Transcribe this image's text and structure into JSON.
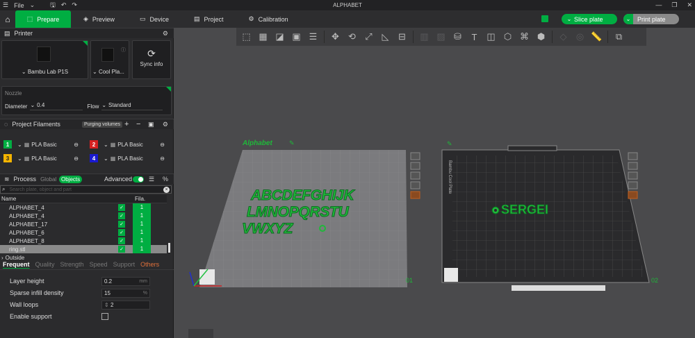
{
  "app": {
    "title": "ALPHABET",
    "menu_label": "File"
  },
  "tabs": [
    {
      "label": "Prepare"
    },
    {
      "label": "Preview"
    },
    {
      "label": "Device"
    },
    {
      "label": "Project"
    },
    {
      "label": "Calibration"
    }
  ],
  "actions": {
    "slice_label": "Slice plate",
    "print_label": "Print plate"
  },
  "printer": {
    "section_label": "Printer",
    "model": "Bambu Lab P1S",
    "plate": "Cool Pla...",
    "sync_label": "Sync info"
  },
  "nozzle": {
    "label": "Nozzle",
    "diameter_label": "Diameter",
    "diameter_value": "0.4",
    "flow_label": "Flow",
    "flow_value": "Standard"
  },
  "filaments": {
    "section_label": "Project Filaments",
    "purging_label": "Purging volumes",
    "items": [
      {
        "num": "1",
        "name": "PLA Basic",
        "color": "#00ae42"
      },
      {
        "num": "2",
        "name": "PLA Basic",
        "color": "#d62020"
      },
      {
        "num": "3",
        "name": "PLA Basic",
        "color": "#f5b400"
      },
      {
        "num": "4",
        "name": "PLA Basic",
        "color": "#1a1ad0"
      }
    ]
  },
  "process": {
    "section_label": "Process",
    "global_label": "Global",
    "objects_label": "Objects",
    "advanced_label": "Advanced",
    "search_placeholder": "Search plate, object and part",
    "col_name": "Name",
    "col_fila": "Fila.",
    "objects": [
      {
        "name": "ALPHABET_4",
        "fila": "1"
      },
      {
        "name": "ALPHABET_4",
        "fila": "1"
      },
      {
        "name": "ALPHABET_17",
        "fila": "1"
      },
      {
        "name": "ALPHABET_6",
        "fila": "1"
      },
      {
        "name": "ALPHABET_8",
        "fila": "1"
      },
      {
        "name": "ring.stl",
        "fila": "1"
      }
    ],
    "outside_label": "Outside",
    "subtabs": [
      "Frequent",
      "Quality",
      "Strength",
      "Speed",
      "Support",
      "Others"
    ],
    "params": {
      "layer_height_label": "Layer height",
      "layer_height_value": "0.2",
      "layer_height_unit": "mm",
      "infill_label": "Sparse infill density",
      "infill_value": "15",
      "infill_unit": "%",
      "walls_label": "Wall loops",
      "walls_value": "2",
      "support_label": "Enable support"
    }
  },
  "viewport": {
    "plate1": {
      "name": "Alphabet",
      "number": "01",
      "text_lines": [
        "ABCDEFGHIJK",
        "LMNOPQRSTU",
        "VWXYZ"
      ]
    },
    "plate2": {
      "number": "02",
      "text": "SERGEI",
      "side_label": "Bambu Cool Plate"
    }
  },
  "colors": {
    "accent": "#00ae42",
    "model": "#1fb83a"
  }
}
